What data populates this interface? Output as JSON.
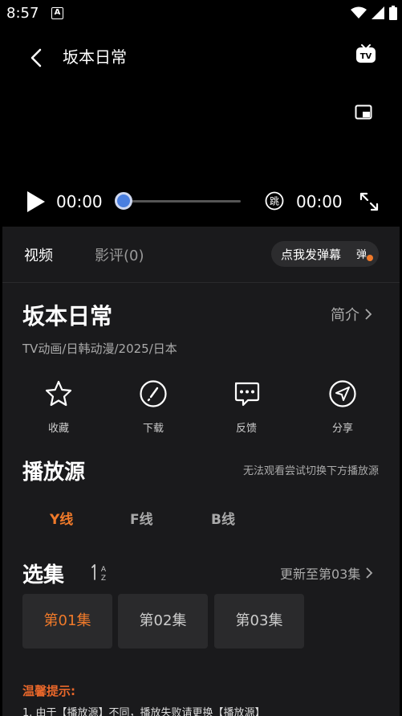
{
  "status_bar": {
    "time": "8:57",
    "notification_glyph": "A"
  },
  "player": {
    "title": "坂本日常",
    "current_time": "00:00",
    "total_time": "00:00",
    "progress_fraction": 0,
    "skip_glyph": "跳"
  },
  "tabs": {
    "video": "视频",
    "review": "影评(0)"
  },
  "danmaku": {
    "label": "点我发弹幕",
    "icon_glyph": "弹"
  },
  "show": {
    "title": "坂本日常",
    "intro": "简介",
    "meta": "TV动画/日韩动漫/2025/日本"
  },
  "actions": [
    {
      "icon": "star-icon",
      "label": "收藏"
    },
    {
      "icon": "download-icon",
      "label": "下载"
    },
    {
      "icon": "feedback-icon",
      "label": "反馈"
    },
    {
      "icon": "share-icon",
      "label": "分享"
    }
  ],
  "source": {
    "heading": "播放源",
    "hint": "无法观看尝试切换下方播放源",
    "lines": [
      "Y线",
      "F线",
      "B线"
    ],
    "selected_index": 0
  },
  "episodes": {
    "heading": "选集",
    "update": "更新至第03集",
    "items": [
      "第01集",
      "第02集",
      "第03集"
    ],
    "selected_index": 0
  },
  "tips": {
    "title": "温馨提示:",
    "line1": "1. 由于【播放源】不同，播放失败请更换【播放源】"
  },
  "colors": {
    "accent": "#f07a2a",
    "progress_knob": "#4a7fe0",
    "panel": "#1a1a1c"
  }
}
